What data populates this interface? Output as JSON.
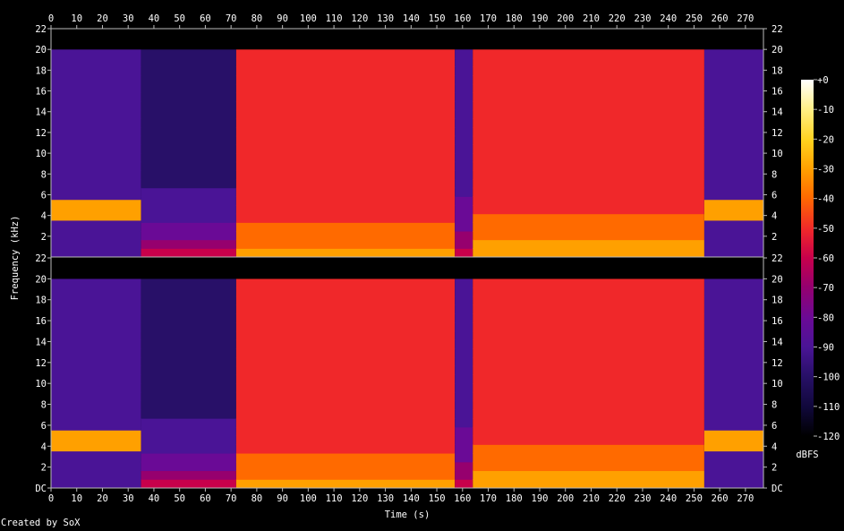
{
  "chart_data": {
    "type": "heatmap",
    "title": "",
    "xlabel": "Time (s)",
    "ylabel": "Frequency (kHz)",
    "xlim": [
      0,
      277
    ],
    "ylim": [
      0,
      22
    ],
    "x_ticks": [
      "0",
      "10",
      "20",
      "30",
      "40",
      "50",
      "60",
      "70",
      "80",
      "90",
      "100",
      "110",
      "120",
      "130",
      "140",
      "150",
      "160",
      "170",
      "180",
      "190",
      "200",
      "210",
      "220",
      "230",
      "240",
      "250",
      "260",
      "270"
    ],
    "y_ticks": [
      "DC",
      "2",
      "4",
      "6",
      "8",
      "10",
      "12",
      "14",
      "16",
      "18",
      "20",
      "22"
    ],
    "channels": 2,
    "colorbar": {
      "label": "dBFS",
      "range": [
        -120,
        0
      ],
      "ticks": [
        "+0",
        "-10",
        "-20",
        "-30",
        "-40",
        "-50",
        "-60",
        "-70",
        "-80",
        "-90",
        "-100",
        "-110",
        "-120"
      ],
      "colors": [
        "#ffffff",
        "#fff08a",
        "#ffd21e",
        "#ffa000",
        "#ff6a00",
        "#f0282a",
        "#c8004b",
        "#96006e",
        "#6a0a96",
        "#4a1496",
        "#281068",
        "#10083a",
        "#000000"
      ]
    },
    "segments": [
      {
        "start": 0,
        "end": 35,
        "description_level_db": -85,
        "cutoff_khz": 20,
        "band_khz": [
          3.5,
          5.5
        ],
        "band_db": -30
      },
      {
        "start": 35,
        "end": 72,
        "description_level_db": -100,
        "cutoff_khz": 20,
        "low_db": -60
      },
      {
        "start": 72,
        "end": 157,
        "description_level_db": -55,
        "cutoff_khz": 20,
        "low_db": -30
      },
      {
        "start": 157,
        "end": 164,
        "description_level_db": -90,
        "cutoff_khz": 20,
        "low_db": -60
      },
      {
        "start": 164,
        "end": 254,
        "description_level_db": -52,
        "cutoff_khz": 20,
        "low_db": -25
      },
      {
        "start": 254,
        "end": 277,
        "description_level_db": -90,
        "cutoff_khz": 20,
        "band_khz": [
          3.5,
          5.5
        ],
        "band_db": -30
      }
    ]
  },
  "footer": {
    "created_by": "Created by SoX"
  }
}
